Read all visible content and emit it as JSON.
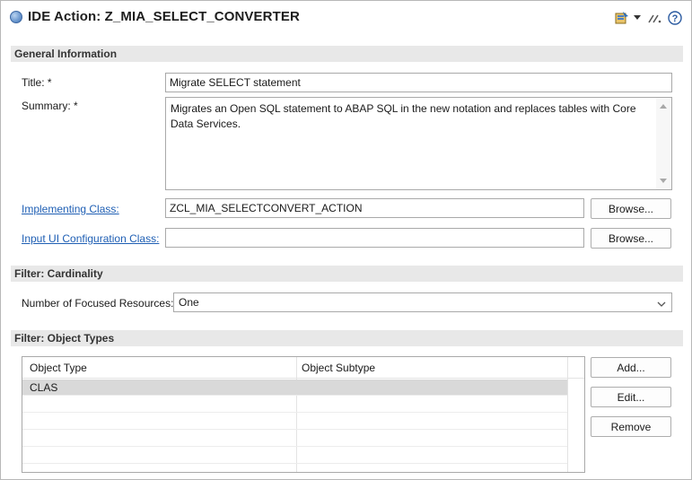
{
  "header": {
    "title": "IDE Action: Z_MIA_SELECT_CONVERTER",
    "icons": {
      "title": "circle-blue-icon",
      "run": "run-action-icon",
      "dropdown": "chevron-down-icon",
      "collapse": "double-slash-icon",
      "help": "help-icon"
    }
  },
  "general": {
    "heading": "General Information",
    "title_label": "Title: *",
    "title_value": "Migrate SELECT statement",
    "summary_label": "Summary: *",
    "summary_value": "Migrates an Open SQL statement to ABAP SQL in the new notation and replaces tables with Core Data Services.",
    "impl_label": "Implementing Class:",
    "impl_value": "ZCL_MIA_SELECTCONVERT_ACTION",
    "input_ui_label": "Input UI Configuration Class:",
    "input_ui_value": "",
    "browse_label": "Browse..."
  },
  "cardinality": {
    "heading": "Filter: Cardinality",
    "focused_label": "Number of Focused Resources:",
    "focused_value": "One"
  },
  "object_types": {
    "heading": "Filter: Object Types",
    "columns": [
      "Object Type",
      "Object Subtype"
    ],
    "rows": [
      {
        "type": "CLAS",
        "subtype": ""
      }
    ],
    "add_label": "Add...",
    "edit_label": "Edit...",
    "remove_label": "Remove"
  },
  "colors": {
    "section_bg": "#e8e8e8",
    "link": "#1f5fb4",
    "selected_row": "#d9d9d9"
  }
}
